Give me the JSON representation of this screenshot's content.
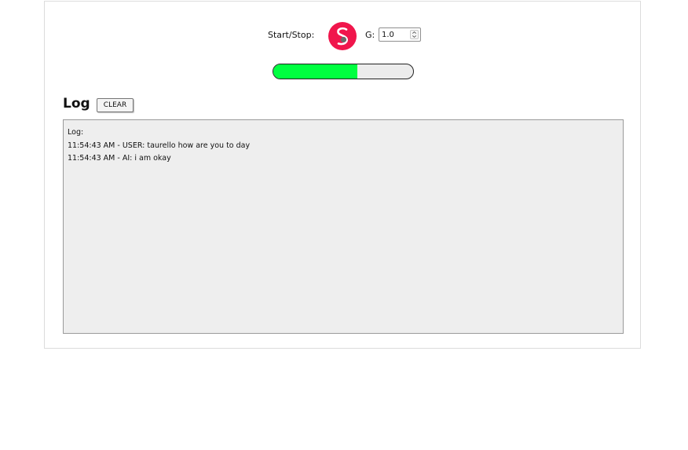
{
  "controls": {
    "start_stop_label": "Start/Stop:",
    "logo_icon": "circular-s-logo-icon",
    "logo_color": "#f0164c",
    "g_label": "G:",
    "g_value": "1.0"
  },
  "progress": {
    "fraction": 0.6,
    "fill_color": "#00ff40"
  },
  "log": {
    "title": "Log",
    "clear_label": "CLEAR",
    "lines": [
      "Log:",
      "11:54:43 AM - USER: taurello how are you to day",
      "11:54:43 AM - AI: i am okay"
    ]
  }
}
